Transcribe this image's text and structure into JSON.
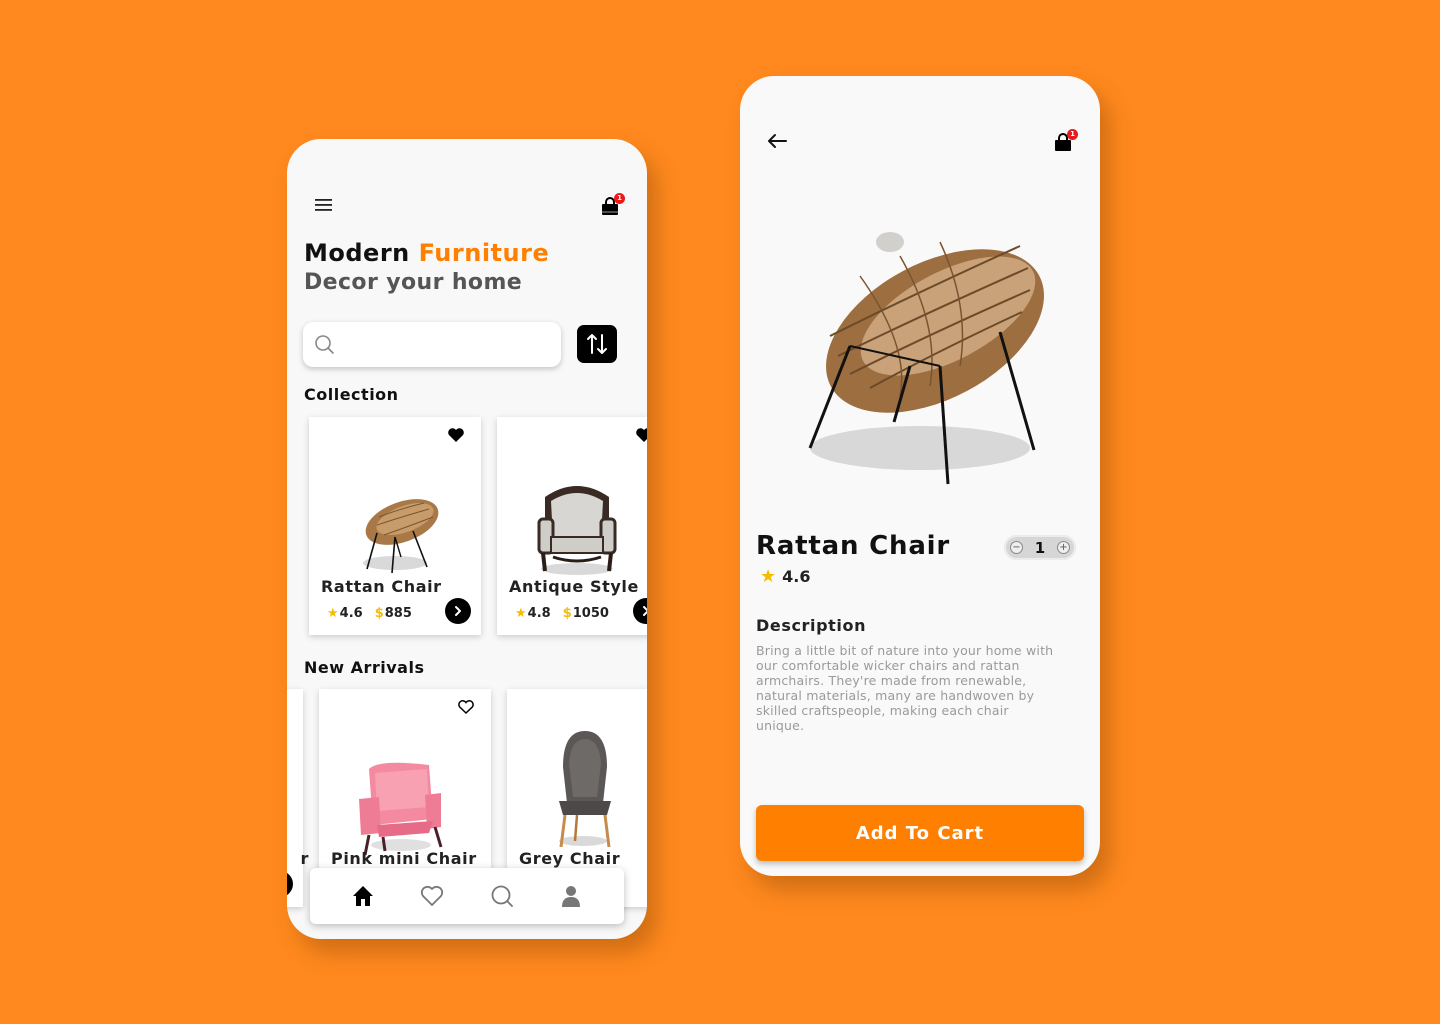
{
  "home": {
    "cart_badge": "1",
    "title": {
      "part1": "Modern",
      "part2": "Furniture"
    },
    "subtitle": "Decor your home",
    "search": {
      "placeholder": ""
    },
    "sections": {
      "collection": "Collection",
      "new_arrivals": "New Arrivals"
    },
    "collection": [
      {
        "name": "Rattan Chair",
        "rating": "4.6",
        "price": "885"
      },
      {
        "name": "Antique Style",
        "rating": "4.8",
        "price": "1050"
      }
    ],
    "new_arrivals": [
      {
        "name": "Pink mini Chair",
        "favorited": false
      },
      {
        "name": "Grey Chair",
        "favorited": false
      }
    ],
    "prev_card_tail": "r",
    "nav": [
      "home-icon",
      "heart-icon",
      "search-icon",
      "user-icon"
    ]
  },
  "detail": {
    "cart_badge": "1",
    "product_name": "Rattan Chair",
    "rating": "4.6",
    "quantity": "1",
    "description_title": "Description",
    "description": "Bring a little bit of nature into your home with our comfortable wicker chairs and rattan armchairs. They're made from renewable, natural materials, many are handwoven by skilled craftspeople, making each chair unique.",
    "add_to_cart": "Add To Cart"
  },
  "colors": {
    "background": "#FF891E",
    "accent": "#FF7F00",
    "star": "#F5BC00",
    "badge": "#E81B1B"
  }
}
